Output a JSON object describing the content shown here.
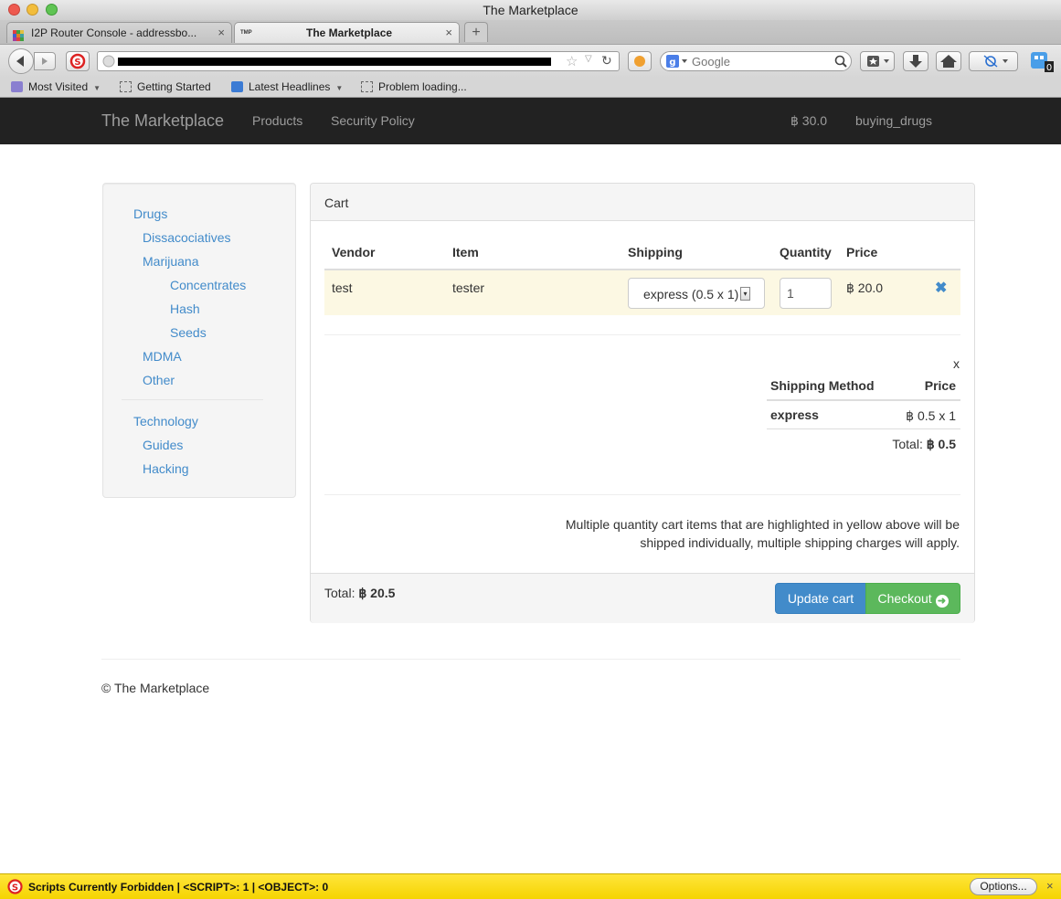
{
  "window": {
    "title": "The Marketplace"
  },
  "tabs": [
    {
      "label": "I2P Router Console - addressbo...",
      "close": "×"
    },
    {
      "label": "The Marketplace",
      "close": "×",
      "favicon_text": "TMP"
    }
  ],
  "new_tab_label": "+",
  "search": {
    "placeholder": "Google"
  },
  "bookmarks": [
    {
      "label": "Most Visited",
      "dropdown": true
    },
    {
      "label": "Getting Started"
    },
    {
      "label": "Latest Headlines",
      "dropdown": true
    },
    {
      "label": "Problem loading..."
    }
  ],
  "site_nav": {
    "brand": "The Marketplace",
    "links": [
      "Products",
      "Security Policy"
    ],
    "balance": "฿ 30.0",
    "user": "buying_drugs"
  },
  "sidebar": {
    "items": [
      "Drugs",
      "Dissacociatives",
      "Marijuana",
      "Concentrates",
      "Hash",
      "Seeds",
      "MDMA",
      "Other",
      "Technology",
      "Guides",
      "Hacking"
    ]
  },
  "cart": {
    "heading": "Cart",
    "columns": [
      "Vendor",
      "Item",
      "Shipping",
      "Quantity",
      "Price"
    ],
    "row": {
      "vendor": "test",
      "item": "tester",
      "shipping": "express (0.5 x 1)",
      "quantity": "1",
      "price": "฿ 20.0"
    },
    "shipping_table": {
      "close": "x",
      "headers": [
        "Shipping Method",
        "Price"
      ],
      "method": "express",
      "price": "฿ 0.5 x 1",
      "total_label": "Total:",
      "total_value": "฿ 0.5"
    },
    "notice_line1": "Multiple quantity cart items that are highlighted in yellow above will be",
    "notice_line2": "shipped individually, multiple shipping charges will apply.",
    "footer_total_label": "Total:",
    "footer_total_value": "฿ 20.5",
    "update_label": "Update cart",
    "checkout_label": "Checkout"
  },
  "footer": {
    "copyright": "© The Marketplace"
  },
  "statusbar": {
    "text": "Scripts Currently Forbidden | <SCRIPT>: 1 | <OBJECT>: 0",
    "options_label": "Options...",
    "close": "×"
  }
}
